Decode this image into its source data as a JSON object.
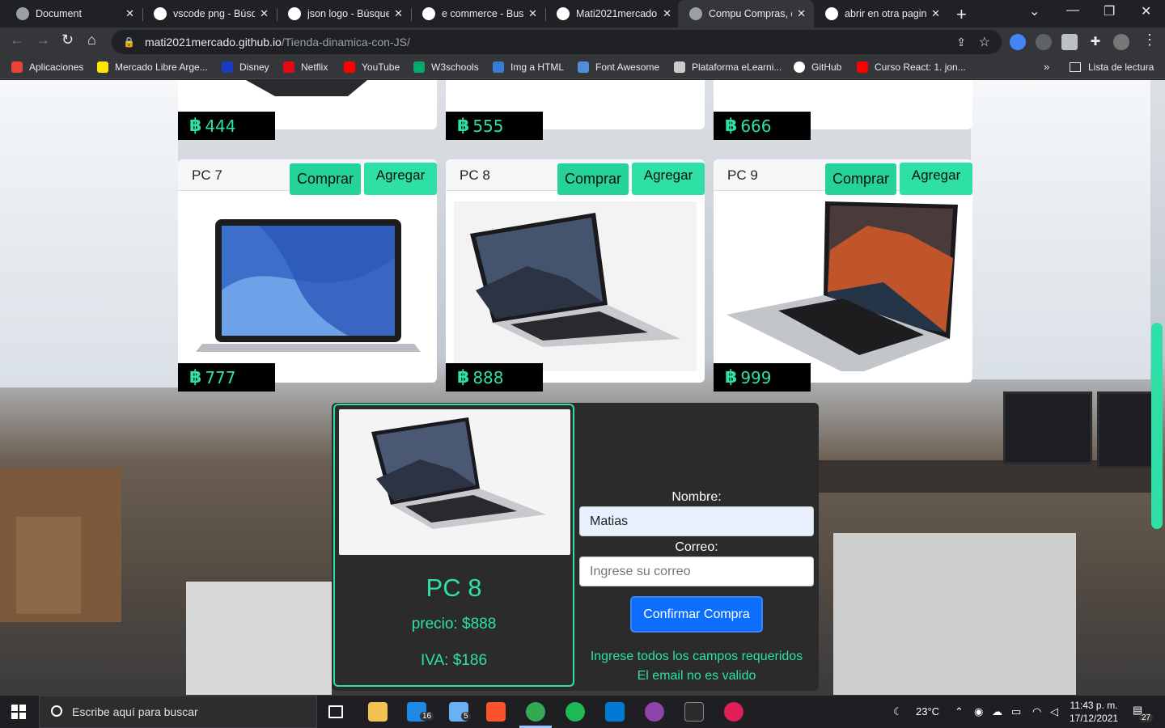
{
  "tabs": [
    {
      "title": "Document",
      "favicon_color": "#9aa0a6",
      "active": false
    },
    {
      "title": "vscode png - Búsqu",
      "favicon_color": "#ffffff",
      "active": false
    },
    {
      "title": "json logo - Búsque",
      "favicon_color": "#ffffff",
      "active": false
    },
    {
      "title": "e commerce - Busc",
      "favicon_color": "#ffffff",
      "active": false
    },
    {
      "title": "Mati2021mercado",
      "favicon_color": "#ffffff",
      "active": false
    },
    {
      "title": "Compu Compras, c",
      "favicon_color": "#9aa0a6",
      "active": true
    },
    {
      "title": "abrir en otra pagina",
      "favicon_color": "#ffffff",
      "active": false
    }
  ],
  "address": {
    "host": "mati2021mercado.github.io",
    "path": "/Tienda-dinamica-con-JS/"
  },
  "bookmarks": [
    {
      "label": "Aplicaciones",
      "color": "#ea4335"
    },
    {
      "label": "Mercado Libre Arge...",
      "color": "#ffe600"
    },
    {
      "label": "Disney",
      "color": "#1a3cc4"
    },
    {
      "label": "Netflix",
      "color": "#e50914"
    },
    {
      "label": "YouTube",
      "color": "#ff0000"
    },
    {
      "label": "W3schools",
      "color": "#04aa6d"
    },
    {
      "label": "Img a HTML",
      "color": "#3a7bd5"
    },
    {
      "label": "Font Awesome",
      "color": "#528dd7"
    },
    {
      "label": "Plataforma eLearni...",
      "color": "#cccccc"
    },
    {
      "label": "GitHub",
      "color": "#ffffff"
    },
    {
      "label": "Curso React: 1. jon...",
      "color": "#ff0000"
    }
  ],
  "bookmarks_more": "»",
  "reading_list": "Lista de lectura",
  "currency_symbol": "฿",
  "top_prices": [
    "444",
    "555",
    "666"
  ],
  "products": [
    {
      "name": "PC 7",
      "buy_label": "Comprar",
      "add_label": "Agregar",
      "price": "777"
    },
    {
      "name": "PC 8",
      "buy_label": "Comprar",
      "add_label": "Agregar",
      "price": "888"
    },
    {
      "name": "PC 9",
      "buy_label": "Comprar",
      "add_label": "Agregar",
      "price": "999"
    }
  ],
  "purchase": {
    "title": "PC 8",
    "price_text": "precio: $888",
    "iva_text": "IVA: $186",
    "name_label": "Nombre:",
    "name_value": "Matias",
    "email_label": "Correo:",
    "email_placeholder": "Ingrese su correo",
    "confirm_label": "Confirmar Compra",
    "error_1": "Ingrese todos los campos requeridos",
    "error_2": "El email no es valido"
  },
  "accent_color": "#2ee0a6",
  "taskbar": {
    "search_placeholder": "Escribe aquí para buscar",
    "mail_badge": "16",
    "files_badge": "5",
    "weather": "23°C",
    "time": "11:43 p. m.",
    "date": "17/12/2021",
    "notif_count": "27"
  }
}
